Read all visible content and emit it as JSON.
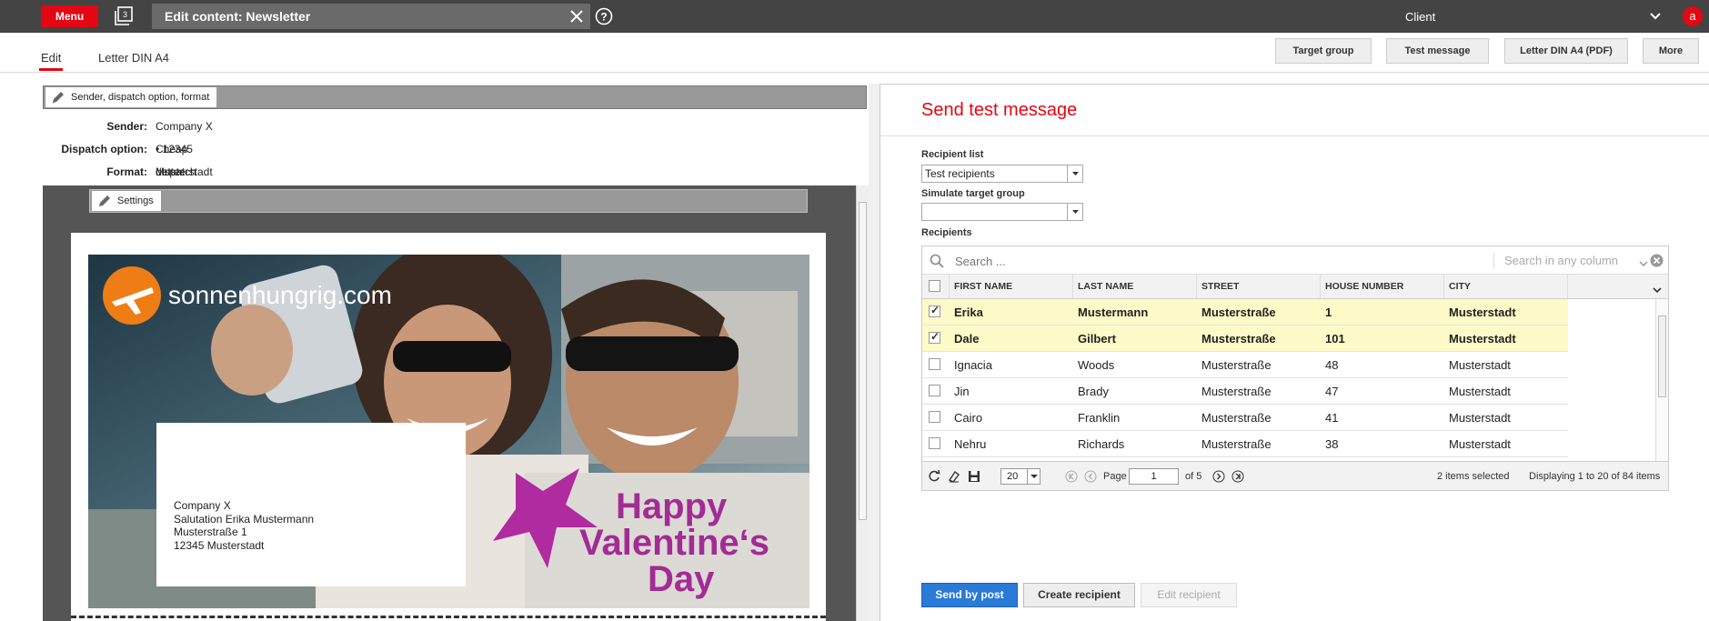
{
  "topbar": {
    "menu_label": "Menu",
    "stack_count": "3",
    "title": "Edit content: Newsletter",
    "client_label": "Client",
    "avatar_letter": "a"
  },
  "tabs": [
    {
      "label": "Edit",
      "active": true
    },
    {
      "label": "Letter DIN A4",
      "active": false
    }
  ],
  "toolbar": {
    "target_group": "Target group",
    "test_message": "Test message",
    "letter_pdf": "Letter DIN A4 (PDF)",
    "more": "More"
  },
  "left": {
    "panel_title": "Sender, dispatch option, format",
    "sender_label": "Sender:",
    "sender_value": "Company X • 12345 Musterstadt",
    "dispatch_label": "Dispatch option:",
    "dispatch_value": "Cheap dispatch",
    "format_label": "Format:",
    "format_value": "Letter DIN A4",
    "settings_title": "Settings",
    "logo_text": "sonnenhungrig.com",
    "promo_line1": "Happy",
    "promo_line2": "Valentine‘s",
    "promo_line3": "Day",
    "address": [
      "Company X",
      "Salutation Erika Mustermann",
      "Musterstraße 1",
      "12345 Musterstadt"
    ]
  },
  "right": {
    "title": "Send test message",
    "recipient_list_label": "Recipient list",
    "recipient_list_value": "Test recipients",
    "simulate_label": "Simulate target group",
    "simulate_value": "",
    "recipients_label": "Recipients",
    "search_placeholder": "Search ...",
    "search_column": "Search in any column",
    "columns": [
      "FIRST NAME",
      "LAST NAME",
      "STREET",
      "HOUSE NUMBER",
      "CITY"
    ],
    "rows": [
      {
        "first": "Erika",
        "last": "Mustermann",
        "street": "Musterstraße",
        "house": "1",
        "city": "Musterstadt",
        "selected": true
      },
      {
        "first": "Dale",
        "last": "Gilbert",
        "street": "Musterstraße",
        "house": "101",
        "city": "Musterstadt",
        "selected": true
      },
      {
        "first": "Ignacia",
        "last": "Woods",
        "street": "Musterstraße",
        "house": "48",
        "city": "Musterstadt",
        "selected": false
      },
      {
        "first": "Jin",
        "last": "Brady",
        "street": "Musterstraße",
        "house": "47",
        "city": "Musterstadt",
        "selected": false
      },
      {
        "first": "Cairo",
        "last": "Franklin",
        "street": "Musterstraße",
        "house": "41",
        "city": "Musterstadt",
        "selected": false
      },
      {
        "first": "Nehru",
        "last": "Richards",
        "street": "Musterstraße",
        "house": "38",
        "city": "Musterstadt",
        "selected": false
      }
    ],
    "pager": {
      "page_size": "20",
      "page_label": "Page",
      "page_value": "1",
      "of_label": "of 5",
      "selected_text": "2 items selected",
      "display_text": "Displaying 1 to 20 of 84 items"
    },
    "buttons": {
      "send_by_post": "Send by post",
      "create_recipient": "Create recipient",
      "edit_recipient": "Edit recipient"
    }
  },
  "colors": {
    "accent": "#e30613",
    "primary_button": "#2a7ad8",
    "selected_row": "#fdfac8",
    "topbar": "#444444"
  }
}
